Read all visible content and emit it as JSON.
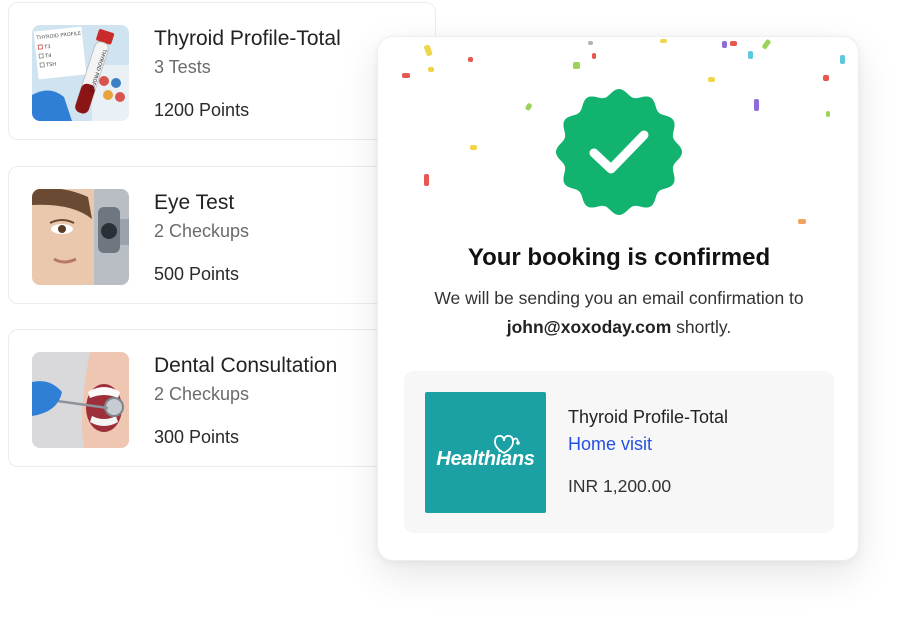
{
  "tests": [
    {
      "title": "Thyroid Profile-Total",
      "subtitle": "3 Tests",
      "points": "1200 Points"
    },
    {
      "title": "Eye Test",
      "subtitle": "2 Checkups",
      "points": "500 Points"
    },
    {
      "title": "Dental Consultation",
      "subtitle": "2 Checkups",
      "points": "300 Points"
    }
  ],
  "thyroid_form": {
    "header": "THYROID PROFILE",
    "checklist": [
      "T3",
      "T4",
      "TSH"
    ],
    "tube_label": "THYROID PROFILE"
  },
  "confirmation": {
    "heading": "Your booking is confirmed",
    "message_line1": "We will be sending you an email confirmation to",
    "email": "john@xoxoday.com",
    "message_suffix": " shortly.",
    "badge_icon": "check-badge-icon",
    "badge_color": "#12b36f"
  },
  "booking": {
    "provider_logo_text": "Healthians",
    "provider_color": "#1ba1a4",
    "title": "Thyroid Profile-Total",
    "visit_type": "Home visit",
    "visit_type_color": "#2450e0",
    "price": "INR 1,200.00"
  }
}
